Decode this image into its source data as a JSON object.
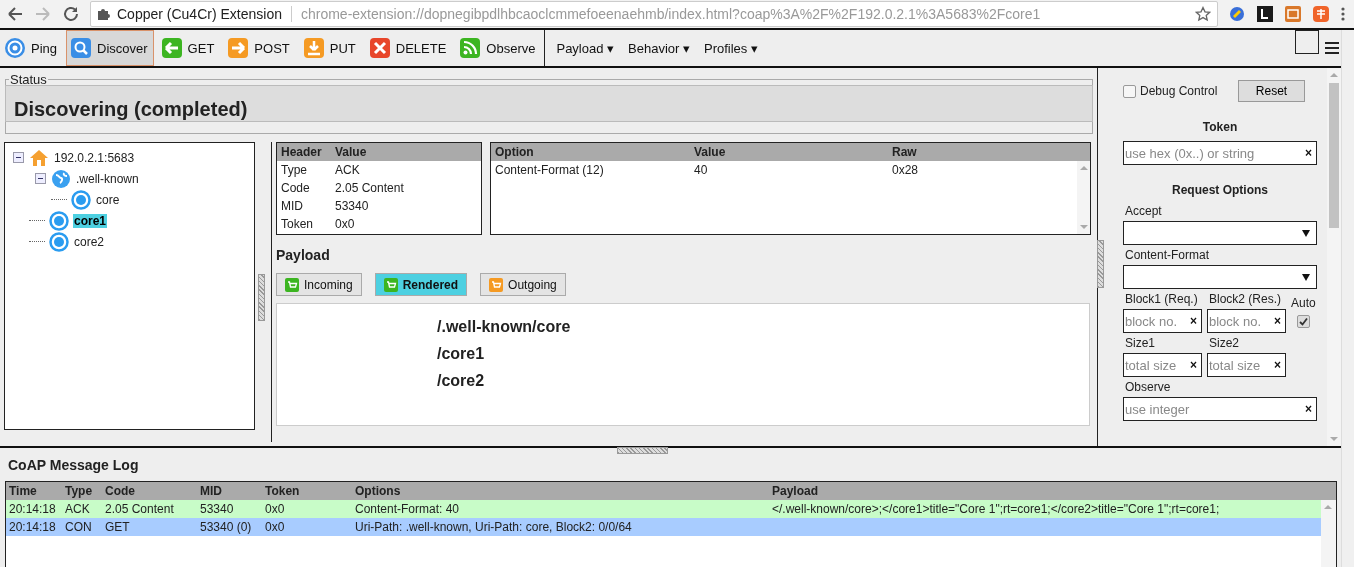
{
  "browser": {
    "tab_title": "Copper (Cu4Cr) Extension",
    "url": "chrome-extension://dopnegibpdlhbcaoclcmmefoeenaehmb/index.html?coap%3A%2F%2F192.0.2.1%3A5683%2Fcore1"
  },
  "toolbar": {
    "buttons": [
      {
        "label": "Ping",
        "kind": "ping",
        "selected": false
      },
      {
        "label": "Discover",
        "kind": "discover",
        "selected": true
      },
      {
        "label": "GET",
        "kind": "get",
        "selected": false
      },
      {
        "label": "POST",
        "kind": "post",
        "selected": false
      },
      {
        "label": "PUT",
        "kind": "put",
        "selected": false
      },
      {
        "label": "DELETE",
        "kind": "delete",
        "selected": false
      },
      {
        "label": "Observe",
        "kind": "observe",
        "selected": false
      }
    ],
    "menus": [
      "Payload ▾",
      "Behavior ▾",
      "Profiles ▾"
    ]
  },
  "status": {
    "legend": "Status",
    "text": "Discovering (completed)"
  },
  "tree": [
    {
      "label": "192.0.2.1:5683",
      "kind": "host",
      "expanded": true,
      "selected": false,
      "children": [
        {
          "label": ".well-known",
          "kind": "folder",
          "expanded": true,
          "selected": false,
          "children": [
            {
              "label": "core",
              "kind": "resource",
              "selected": false
            }
          ]
        },
        {
          "label": "core1",
          "kind": "resource",
          "selected": true
        },
        {
          "label": "core2",
          "kind": "resource",
          "selected": false
        }
      ]
    }
  ],
  "headers": {
    "columns": [
      "Header",
      "Value"
    ],
    "rows": [
      [
        "Type",
        "ACK"
      ],
      [
        "Code",
        "2.05 Content"
      ],
      [
        "MID",
        "53340"
      ],
      [
        "Token",
        "0x0"
      ]
    ]
  },
  "options": {
    "columns": [
      "Option",
      "Value",
      "Raw"
    ],
    "rows": [
      [
        "Content-Format (12)",
        "40",
        "0x28"
      ]
    ]
  },
  "payload": {
    "title": "Payload",
    "tabs": [
      {
        "label": "Incoming",
        "kind": "incoming",
        "selected": false
      },
      {
        "label": "Rendered",
        "kind": "rendered",
        "selected": true
      },
      {
        "label": "Outgoing",
        "kind": "outgoing",
        "selected": false
      }
    ],
    "lines": [
      "/.well-known/core",
      "/core1",
      "/core2"
    ]
  },
  "sidebar": {
    "debug": {
      "label": "Debug Control",
      "checked": false
    },
    "reset": "Reset",
    "token": {
      "title": "Token",
      "placeholder": "use hex (0x..) or string",
      "clear": "×"
    },
    "request_options": {
      "title": "Request Options",
      "rows": [
        [
          {
            "label": "Accept",
            "kind": "select"
          }
        ],
        [
          {
            "label": "Content-Format",
            "kind": "select"
          }
        ],
        [
          {
            "label": "Block1 (Req.)",
            "kind": "text",
            "placeholder": "block no.",
            "clear": "×"
          },
          {
            "label": "Block2 (Res.)",
            "kind": "text",
            "placeholder": "block no.",
            "clear": "×"
          },
          {
            "label": "Auto",
            "kind": "checkbox",
            "checked": true
          }
        ],
        [
          {
            "label": "Size1",
            "kind": "text",
            "placeholder": "total size",
            "clear": "×"
          },
          {
            "label": "Size2",
            "kind": "text",
            "placeholder": "total size",
            "clear": "×"
          }
        ],
        [
          {
            "label": "Observe",
            "kind": "text",
            "placeholder": "use integer",
            "clear": "×"
          }
        ]
      ]
    }
  },
  "log": {
    "title": "CoAP Message Log",
    "columns": [
      "Time",
      "Type",
      "Code",
      "MID",
      "Token",
      "Options",
      "Payload"
    ],
    "rows": [
      {
        "color": "#c8fcc8",
        "cells": [
          "20:14:18",
          "ACK",
          "2.05 Content",
          "53340",
          "0x0",
          "Content-Format: 40",
          "</.well-known/core>;</core1>title=\"Core 1\";rt=core1;</core2>title=\"Core 1\";rt=core1;"
        ]
      },
      {
        "color": "#a8ccff",
        "cells": [
          "20:14:18",
          "CON",
          "GET",
          "53340 (0)",
          "0x0",
          "Uri-Path: .well-known, Uri-Path: core, Block2: 0/0/64",
          ""
        ]
      }
    ]
  }
}
